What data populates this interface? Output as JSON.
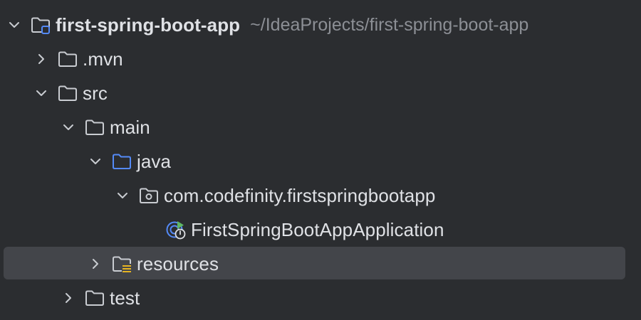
{
  "project_tree": {
    "root": {
      "label": "first-spring-boot-app",
      "path": "~/IdeaProjects/first-spring-boot-app"
    },
    "items": [
      {
        "label": ".mvn"
      },
      {
        "label": "src"
      },
      {
        "label": "main"
      },
      {
        "label": "java"
      },
      {
        "label": "com.codefinity.firstspringbootapp"
      },
      {
        "label": "FirstSpringBootAppApplication"
      },
      {
        "label": "resources"
      },
      {
        "label": "test"
      }
    ]
  },
  "icons": {
    "expanded": "chevron-down-icon",
    "collapsed": "chevron-right-icon",
    "folder": "folder-icon",
    "module": "module-folder-icon",
    "source_root": "source-folder-icon",
    "package": "package-icon",
    "spring_boot_class": "spring-boot-application-icon",
    "resources_root": "resources-folder-icon"
  },
  "colors": {
    "background": "#2b2d30",
    "selection": "#43454a",
    "text": "#dfe1e5",
    "path_text": "#8c8f95",
    "source_folder": "#548af7",
    "spring_green": "#5fb865",
    "resources_yellow": "#e6b422"
  }
}
